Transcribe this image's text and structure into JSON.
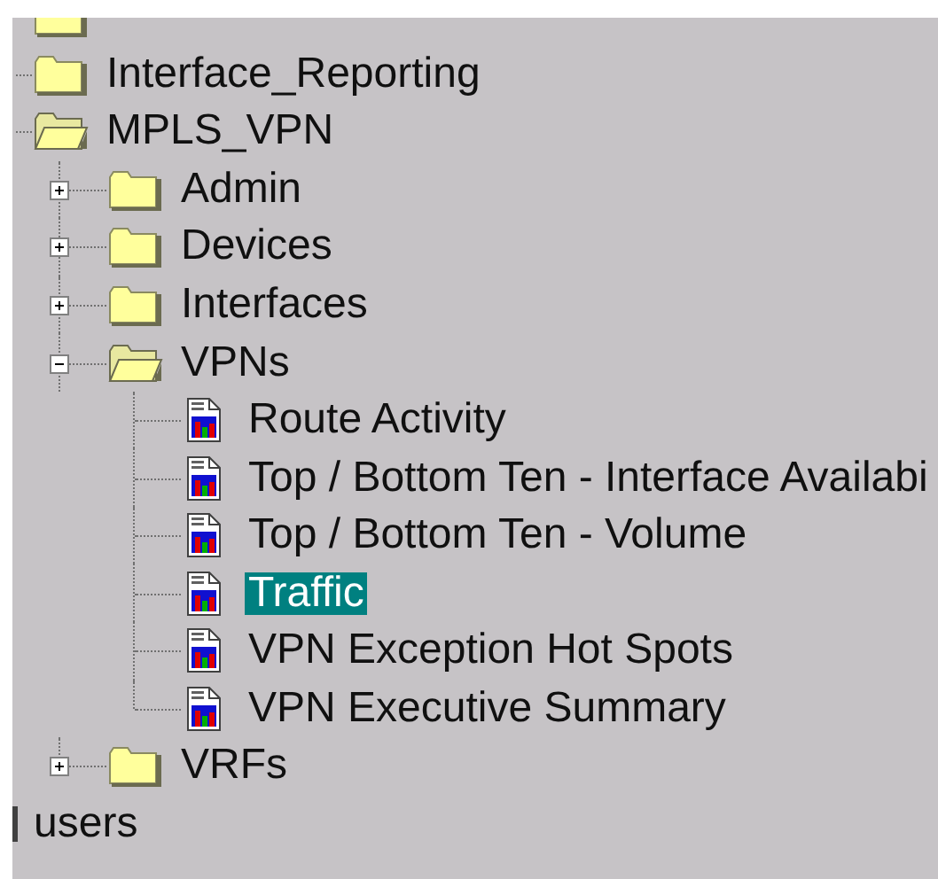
{
  "tree": [
    {
      "kind": "folder",
      "expanded": false
    },
    {
      "label": "Interface_Reporting",
      "kind": "folder",
      "expanded": false,
      "selected": false
    },
    {
      "label": "MPLS_VPN",
      "kind": "folder",
      "expanded": true,
      "selected": false,
      "children": [
        {
          "label": "Admin",
          "kind": "folder",
          "expanded": false,
          "selected": false
        },
        {
          "label": "Devices",
          "kind": "folder",
          "expanded": false,
          "selected": false
        },
        {
          "label": "Interfaces",
          "kind": "folder",
          "expanded": false,
          "selected": false
        },
        {
          "label": "VPNs",
          "kind": "folder",
          "expanded": true,
          "selected": false,
          "children": [
            {
              "label": "Route Activity",
              "kind": "report",
              "selected": false
            },
            {
              "label": "Top / Bottom Ten - Interface Availabi",
              "kind": "report",
              "selected": false
            },
            {
              "label": "Top / Bottom Ten - Volume",
              "kind": "report",
              "selected": false
            },
            {
              "label": "Traffic",
              "kind": "report",
              "selected": true
            },
            {
              "label": "VPN Exception Hot Spots",
              "kind": "report",
              "selected": false
            },
            {
              "label": "VPN Executive Summary",
              "kind": "report",
              "selected": false
            }
          ]
        },
        {
          "label": "VRFs",
          "kind": "folder",
          "expanded": false,
          "selected": false
        }
      ]
    }
  ],
  "outer_item": {
    "label": "users"
  }
}
